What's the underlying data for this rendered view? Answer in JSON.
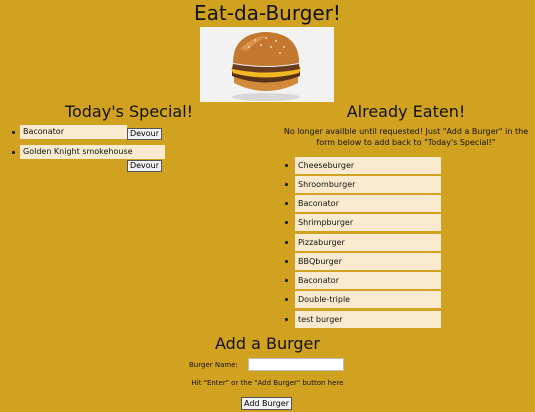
{
  "page": {
    "title": "Eat-da-Burger!"
  },
  "special": {
    "heading": "Today's Special!",
    "devour_label": "Devour",
    "items": [
      {
        "name": "Baconator"
      },
      {
        "name": "Golden Knight smokehouse"
      }
    ]
  },
  "eaten": {
    "heading": "Already Eaten!",
    "note": "No longer availble until requested! Just \"Add a Burger\" in the form below to add back to \"Today's Special!\"",
    "items": [
      {
        "name": "Cheeseburger"
      },
      {
        "name": "Shroomburger"
      },
      {
        "name": "Baconator"
      },
      {
        "name": "Shrimpburger"
      },
      {
        "name": "Pizzaburger"
      },
      {
        "name": "BBQburger"
      },
      {
        "name": "Baconator"
      },
      {
        "name": "Double-triple"
      },
      {
        "name": "test burger"
      }
    ]
  },
  "add_form": {
    "heading": "Add a Burger",
    "name_label": "Burger Name:",
    "name_value": "",
    "hint": "Hit \"Enter\" or the \"Add Burger\" button here",
    "submit_label": "Add Burger"
  }
}
